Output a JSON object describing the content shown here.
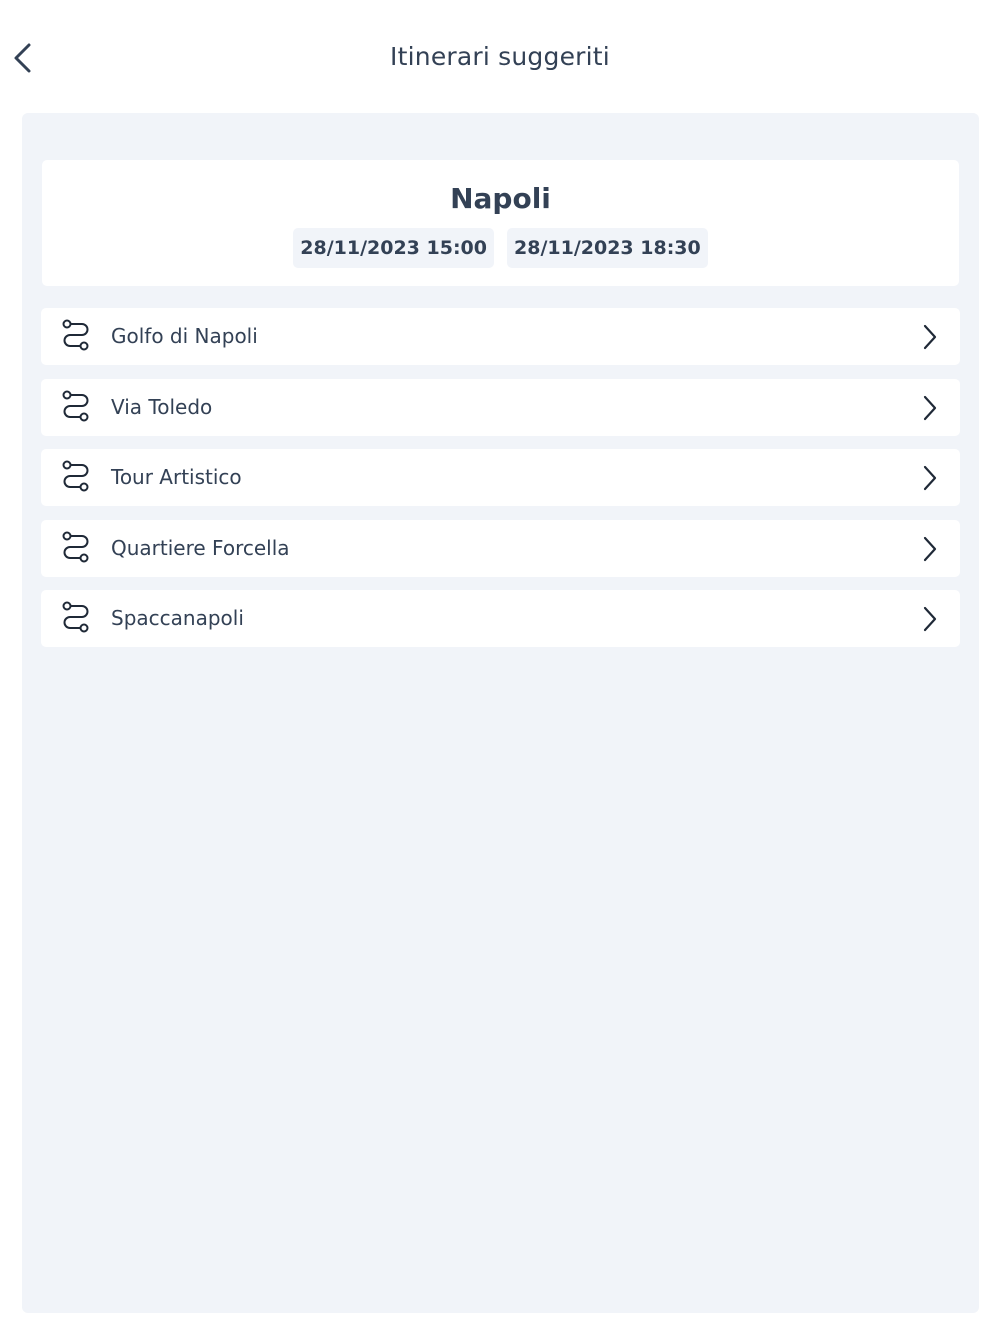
{
  "header": {
    "title": "Itinerari suggeriti",
    "back_icon": "chevron-left-icon"
  },
  "city_card": {
    "city": "Napoli",
    "start": "28/11/2023 15:00",
    "end": "28/11/2023 18:30"
  },
  "itineraries": [
    {
      "label": "Golfo di Napoli",
      "icon": "route-icon"
    },
    {
      "label": "Via Toledo",
      "icon": "route-icon"
    },
    {
      "label": "Tour Artistico",
      "icon": "route-icon"
    },
    {
      "label": "Quartiere Forcella",
      "icon": "route-icon"
    },
    {
      "label": "Spaccanapoli",
      "icon": "route-icon"
    }
  ],
  "colors": {
    "text": "#334155",
    "panel_background": "#f1f4f9",
    "card_background": "#ffffff"
  }
}
